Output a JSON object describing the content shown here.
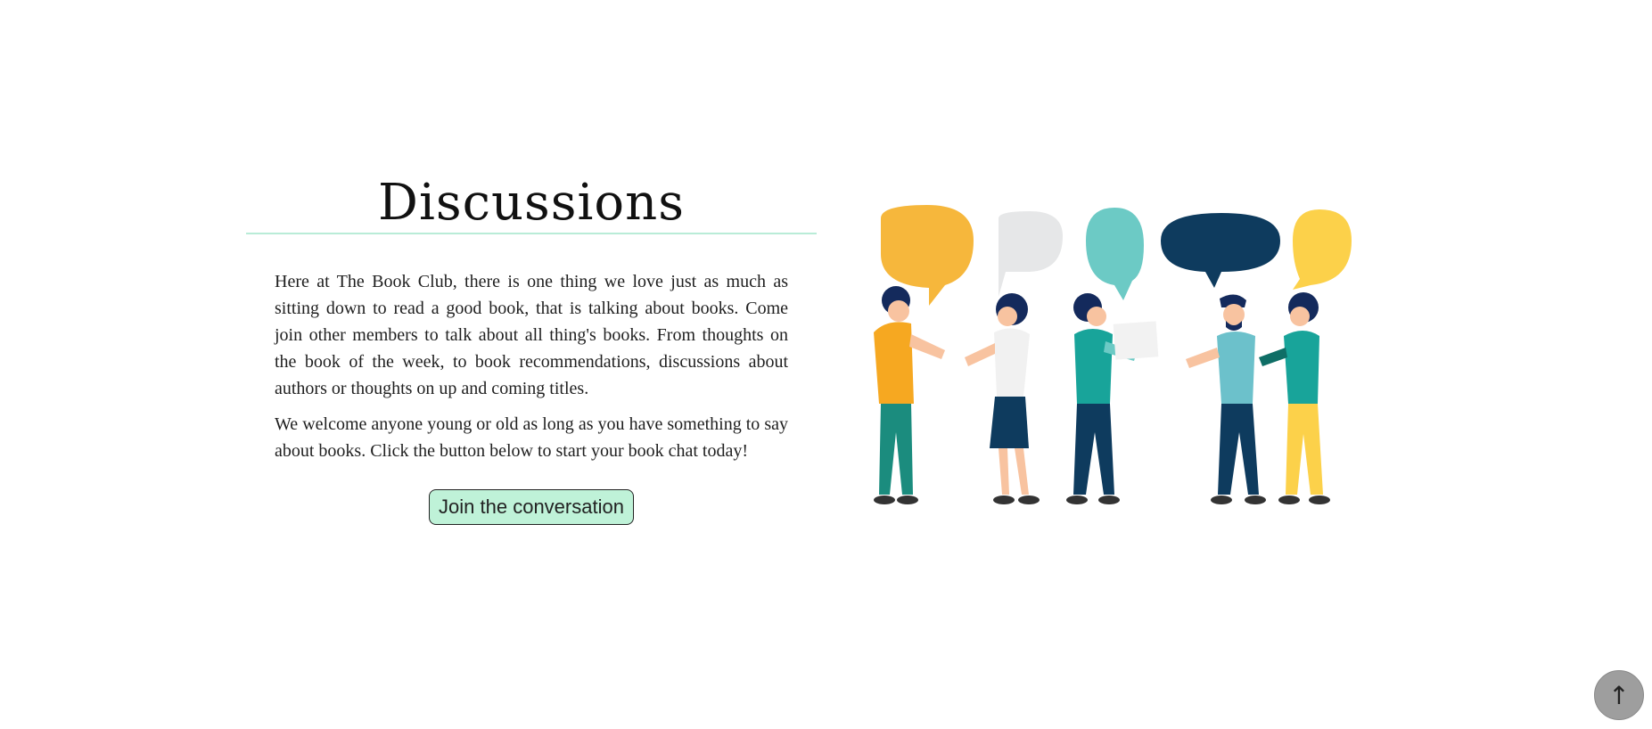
{
  "discussions": {
    "title": "Discussions",
    "paragraph_1": "Here at The Book Club, there is one thing we love just as much as sitting down to read a good book, that is talking about books. Come join other members to talk about all thing's books. From thoughts on the book of the week, to book recommendations, discussions about authors or thoughts on up and coming titles.",
    "paragraph_2": "We welcome anyone young or old as long as you have something to say about books. Click the button below to start your book chat today!",
    "button_label": "Join the conversation"
  },
  "scroll_top": {
    "icon": "arrow-up-icon",
    "glyph": "↑"
  },
  "colors": {
    "divider": "#b9ecd7",
    "button_bg": "#bff2d8",
    "bubble_orange": "#f6b73c",
    "bubble_gray": "#e6e7e8",
    "bubble_teal": "#6ccac5",
    "bubble_navy": "#0e3b5e",
    "bubble_yellow": "#fcd14a"
  }
}
